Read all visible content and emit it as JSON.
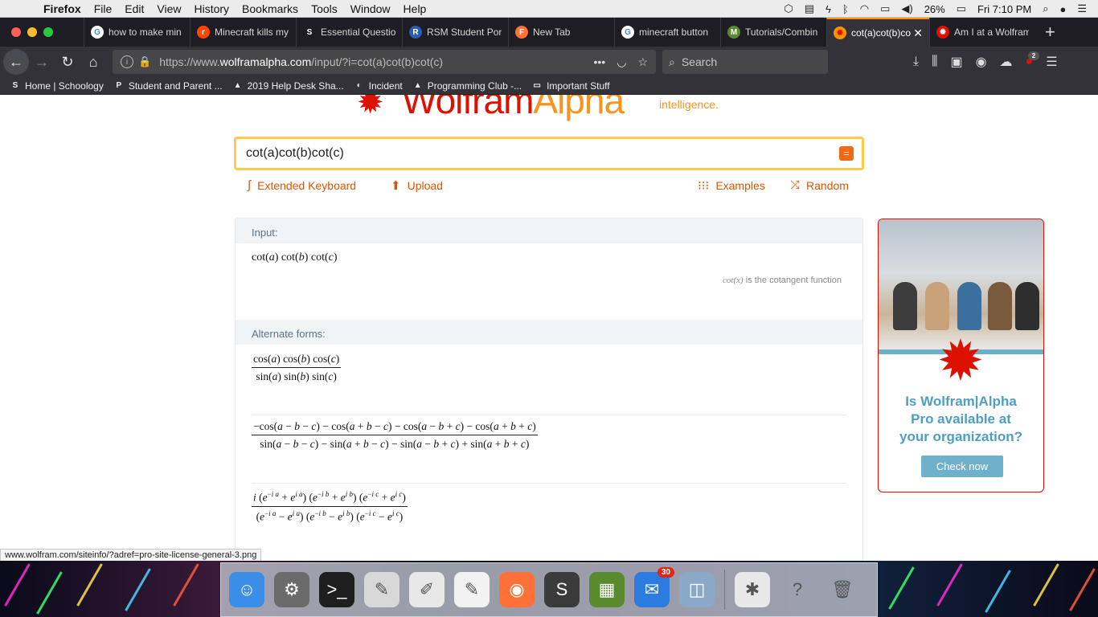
{
  "menubar": {
    "app": "Firefox",
    "menus": [
      "File",
      "Edit",
      "View",
      "History",
      "Bookmarks",
      "Tools",
      "Window",
      "Help"
    ],
    "battery": "26%",
    "clock": "Fri 7:10 PM"
  },
  "tabs": [
    {
      "title": "how to make min",
      "fav": "G",
      "color": "#ffffff",
      "fg": "#4285f4"
    },
    {
      "title": "Minecraft kills my",
      "fav": "r",
      "color": "#ff4500",
      "fg": "#ffffff"
    },
    {
      "title": "Essential Questio",
      "fav": "S",
      "color": "#1d1d23",
      "fg": "#ffffff"
    },
    {
      "title": "RSM Student Por",
      "fav": "R",
      "color": "#2a5db0",
      "fg": "#ffffff"
    },
    {
      "title": "New Tab",
      "fav": "F",
      "color": "#ff7139",
      "fg": "#ffffff"
    },
    {
      "title": "minecraft button",
      "fav": "G",
      "color": "#ffffff",
      "fg": "#4285f4"
    },
    {
      "title": "Tutorials/Combin",
      "fav": "M",
      "color": "#5a8a2e",
      "fg": "#ffffff"
    },
    {
      "title": "cot(a)cot(b)co",
      "fav": "✹",
      "color": "#ff9400",
      "fg": "#dd1100",
      "active": true
    },
    {
      "title": "Am I at a Wolfram",
      "fav": "✹",
      "color": "#dd1100",
      "fg": "#ffffff"
    }
  ],
  "nav": {
    "url_prefix": "https://www.",
    "url_domain": "wolframalpha.com",
    "url_path": "/input/?i=cot(a)cot(b)cot(c)",
    "search_placeholder": "Search",
    "notif_count": "2"
  },
  "bookmarks": [
    {
      "label": "Home | Schoology",
      "icon": "S"
    },
    {
      "label": "Student and Parent ...",
      "icon": "P"
    },
    {
      "label": "2019 Help Desk Sha...",
      "icon": "▲"
    },
    {
      "label": "Incident",
      "icon": "◐"
    },
    {
      "label": "Programming Club -...",
      "icon": "▲"
    },
    {
      "label": "Important Stuff",
      "icon": "▭"
    }
  ],
  "page": {
    "logo_text_1": "Wolfram",
    "logo_text_2": "Alpha",
    "tagline": "intelligence.",
    "query": "cot(a)cot(b)cot(c)",
    "extended_keyboard": "Extended Keyboard",
    "upload": "Upload",
    "examples": "Examples",
    "random": "Random",
    "input_header": "Input:",
    "alt_header": "Alternate forms:",
    "input_note_fn": "cot(x)",
    "input_note_text": " is the cotangent function"
  },
  "ad": {
    "headline_1": "Is Wolfram|Alpha",
    "headline_2": "Pro available at",
    "headline_3": "your organization?",
    "button": "Check now"
  },
  "status_url": "www.wolfram.com/siteinfo/?adref=pro-site-license-general-3.png",
  "dock": [
    {
      "name": "finder",
      "glyph": "☺",
      "color": "#3a8ee6"
    },
    {
      "name": "system-preferences",
      "glyph": "⚙",
      "color": "#6b6b6b"
    },
    {
      "name": "terminal",
      "glyph": ">_",
      "color": "#1e1e1e"
    },
    {
      "name": "script-editor",
      "glyph": "✎",
      "color": "#d8d8d8"
    },
    {
      "name": "textedit-1",
      "glyph": "✐",
      "color": "#e8e8e8"
    },
    {
      "name": "textedit-2",
      "glyph": "✎",
      "color": "#f2f2f2"
    },
    {
      "name": "firefox",
      "glyph": "◉",
      "color": "#ff7139"
    },
    {
      "name": "sublime-text",
      "glyph": "S",
      "color": "#3b3b3b"
    },
    {
      "name": "minecraft",
      "glyph": "▦",
      "color": "#5a8a2e"
    },
    {
      "name": "mail",
      "glyph": "✉",
      "color": "#2b7be0",
      "badge": "30"
    },
    {
      "name": "preview",
      "glyph": "◫",
      "color": "#8aa8c8"
    },
    {
      "name": "grapher",
      "glyph": "✱",
      "color": "#e8e8e8"
    },
    {
      "name": "help",
      "glyph": "?",
      "color": "transparent"
    },
    {
      "name": "trash",
      "glyph": "🗑",
      "color": "transparent"
    }
  ]
}
